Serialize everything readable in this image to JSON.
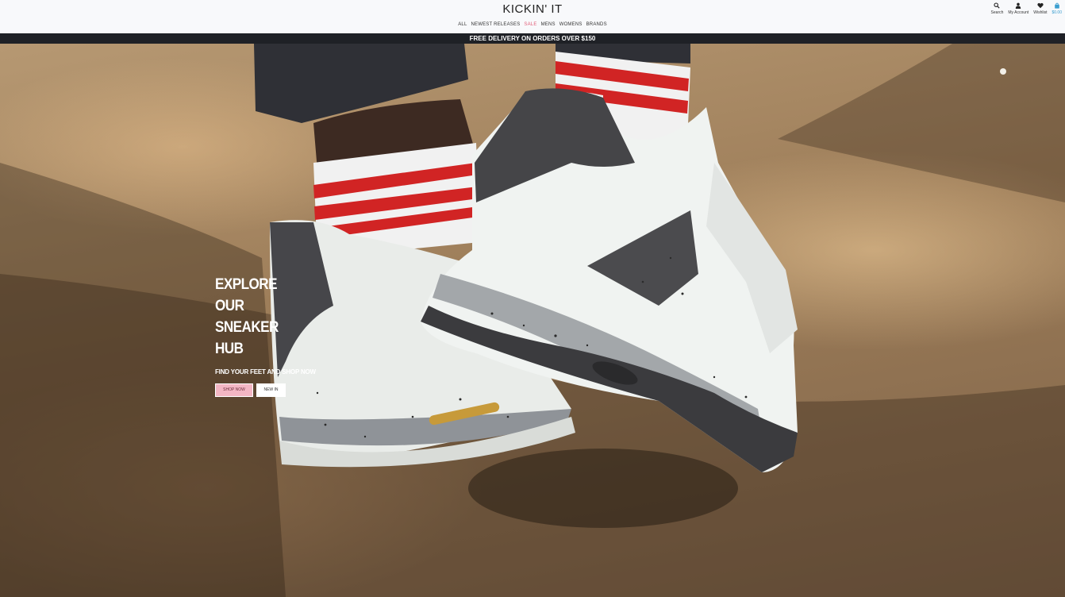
{
  "header": {
    "brand": "KICKIN' IT",
    "nav": [
      {
        "label": "ALL",
        "key": "all"
      },
      {
        "label": "NEWEST RELEASES",
        "key": "newest"
      },
      {
        "label": "SALE",
        "key": "sale"
      },
      {
        "label": "MENS",
        "key": "mens"
      },
      {
        "label": "WOMENS",
        "key": "womens"
      },
      {
        "label": "BRANDS",
        "key": "brands"
      }
    ],
    "icons": {
      "search": {
        "label": "Search",
        "icon": "search-icon"
      },
      "account": {
        "label": "My Account",
        "icon": "user-icon"
      },
      "wishlist": {
        "label": "Wishlist",
        "icon": "heart-icon"
      },
      "cart": {
        "label": "$0.00",
        "icon": "shopping-bag-icon"
      }
    }
  },
  "announcement": "FREE DELIVERY ON ORDERS OVER $150",
  "hero": {
    "title_line1": "EXPLORE OUR",
    "title_line2": "SNEAKER HUB",
    "subtitle": "FIND YOUR FEET AND SHOP NOW",
    "primary_cta": "SHOP NOW",
    "secondary_cta": "NEW IN"
  },
  "colors": {
    "header_bg": "#f8f9fb",
    "announcement_bg": "#1f2126",
    "sale": "#e2607a",
    "cart_amount": "#3a9ecf",
    "primary_cta_bg": "#f3b6c4"
  }
}
